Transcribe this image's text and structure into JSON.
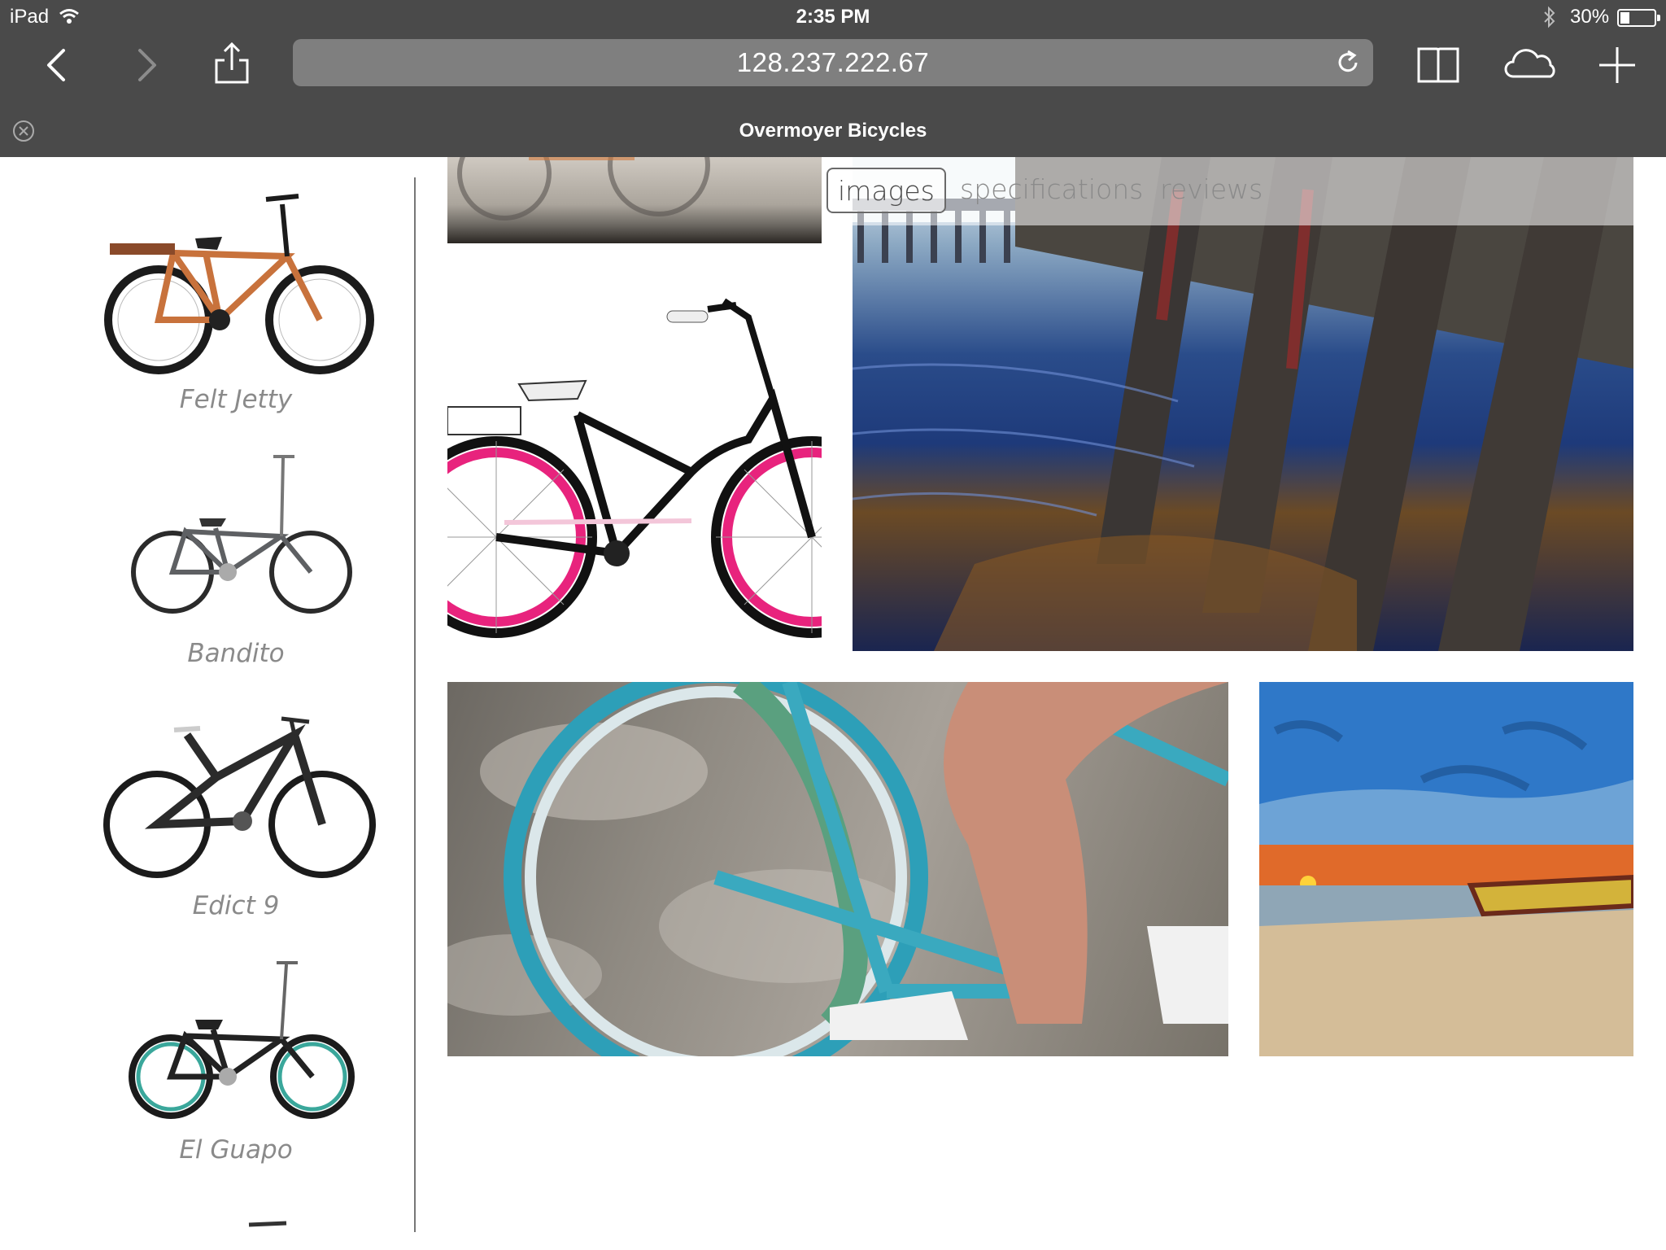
{
  "status_bar": {
    "device": "iPad",
    "time": "2:35 PM",
    "battery_percent": "30%",
    "battery_level": 0.3
  },
  "browser": {
    "address": "128.237.222.67",
    "page_title": "Overmoyer Bicycles",
    "icons": {
      "back": "chevron-left-icon",
      "forward": "chevron-right-icon",
      "share": "share-icon",
      "reload": "reload-icon",
      "bookmarks": "book-icon",
      "icloud_tabs": "cloud-icon",
      "new_tab": "plus-icon",
      "close_tab": "close-circle-icon"
    }
  },
  "sidebar": {
    "bikes": [
      {
        "name": "Felt Jetty",
        "frame_color": "#c8723c"
      },
      {
        "name": "Bandito",
        "frame_color": "#5e6063"
      },
      {
        "name": "Edict 9",
        "frame_color": "#2b2b2b"
      },
      {
        "name": "El Guapo",
        "frame_color": "#222222"
      }
    ]
  },
  "content": {
    "tabs": [
      {
        "label": "images",
        "active": true
      },
      {
        "label": "specifications",
        "active": false
      },
      {
        "label": "reviews",
        "active": false
      }
    ]
  },
  "colors": {
    "chrome": "#4a4a4a",
    "address_bar": "#7f7f7f",
    "sidebar_text": "#8a8a8a",
    "cruiser_rim": "#e8237d",
    "rider_frame": "#3aa9bf"
  }
}
